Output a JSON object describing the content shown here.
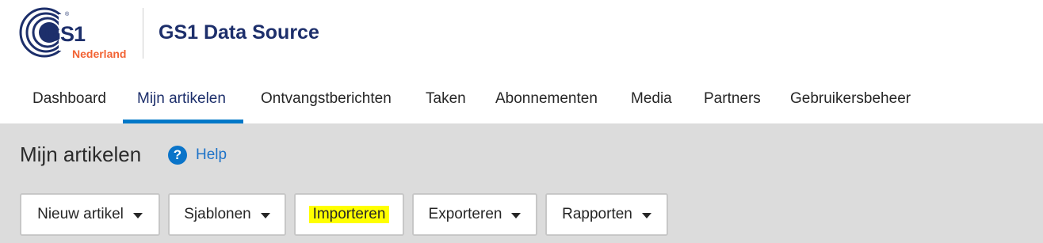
{
  "brand": {
    "logo_text": "GS1",
    "logo_subtext": "Nederland",
    "app_title": "GS1 Data Source"
  },
  "nav": {
    "tabs": [
      {
        "label": "Dashboard"
      },
      {
        "label": "Mijn artikelen",
        "active": true
      },
      {
        "label": "Ontvangstberichten"
      },
      {
        "label": "Taken"
      },
      {
        "label": "Abonnementen"
      },
      {
        "label": "Media"
      },
      {
        "label": "Partners"
      },
      {
        "label": "Gebruikersbeheer"
      }
    ]
  },
  "page": {
    "title": "Mijn artikelen",
    "help_label": "Help"
  },
  "toolbar": {
    "buttons": [
      {
        "label": "Nieuw artikel",
        "has_dropdown": true
      },
      {
        "label": "Sjablonen",
        "has_dropdown": true
      },
      {
        "label": "Importeren",
        "has_dropdown": false,
        "highlighted": true
      },
      {
        "label": "Exporteren",
        "has_dropdown": true
      },
      {
        "label": "Rapporten",
        "has_dropdown": true
      }
    ]
  },
  "colors": {
    "brand_navy": "#1d2f6b",
    "accent_blue": "#0078c8",
    "logo_orange": "#f26334",
    "highlight_yellow": "#ffff00",
    "content_gray": "#dcdcdc"
  }
}
